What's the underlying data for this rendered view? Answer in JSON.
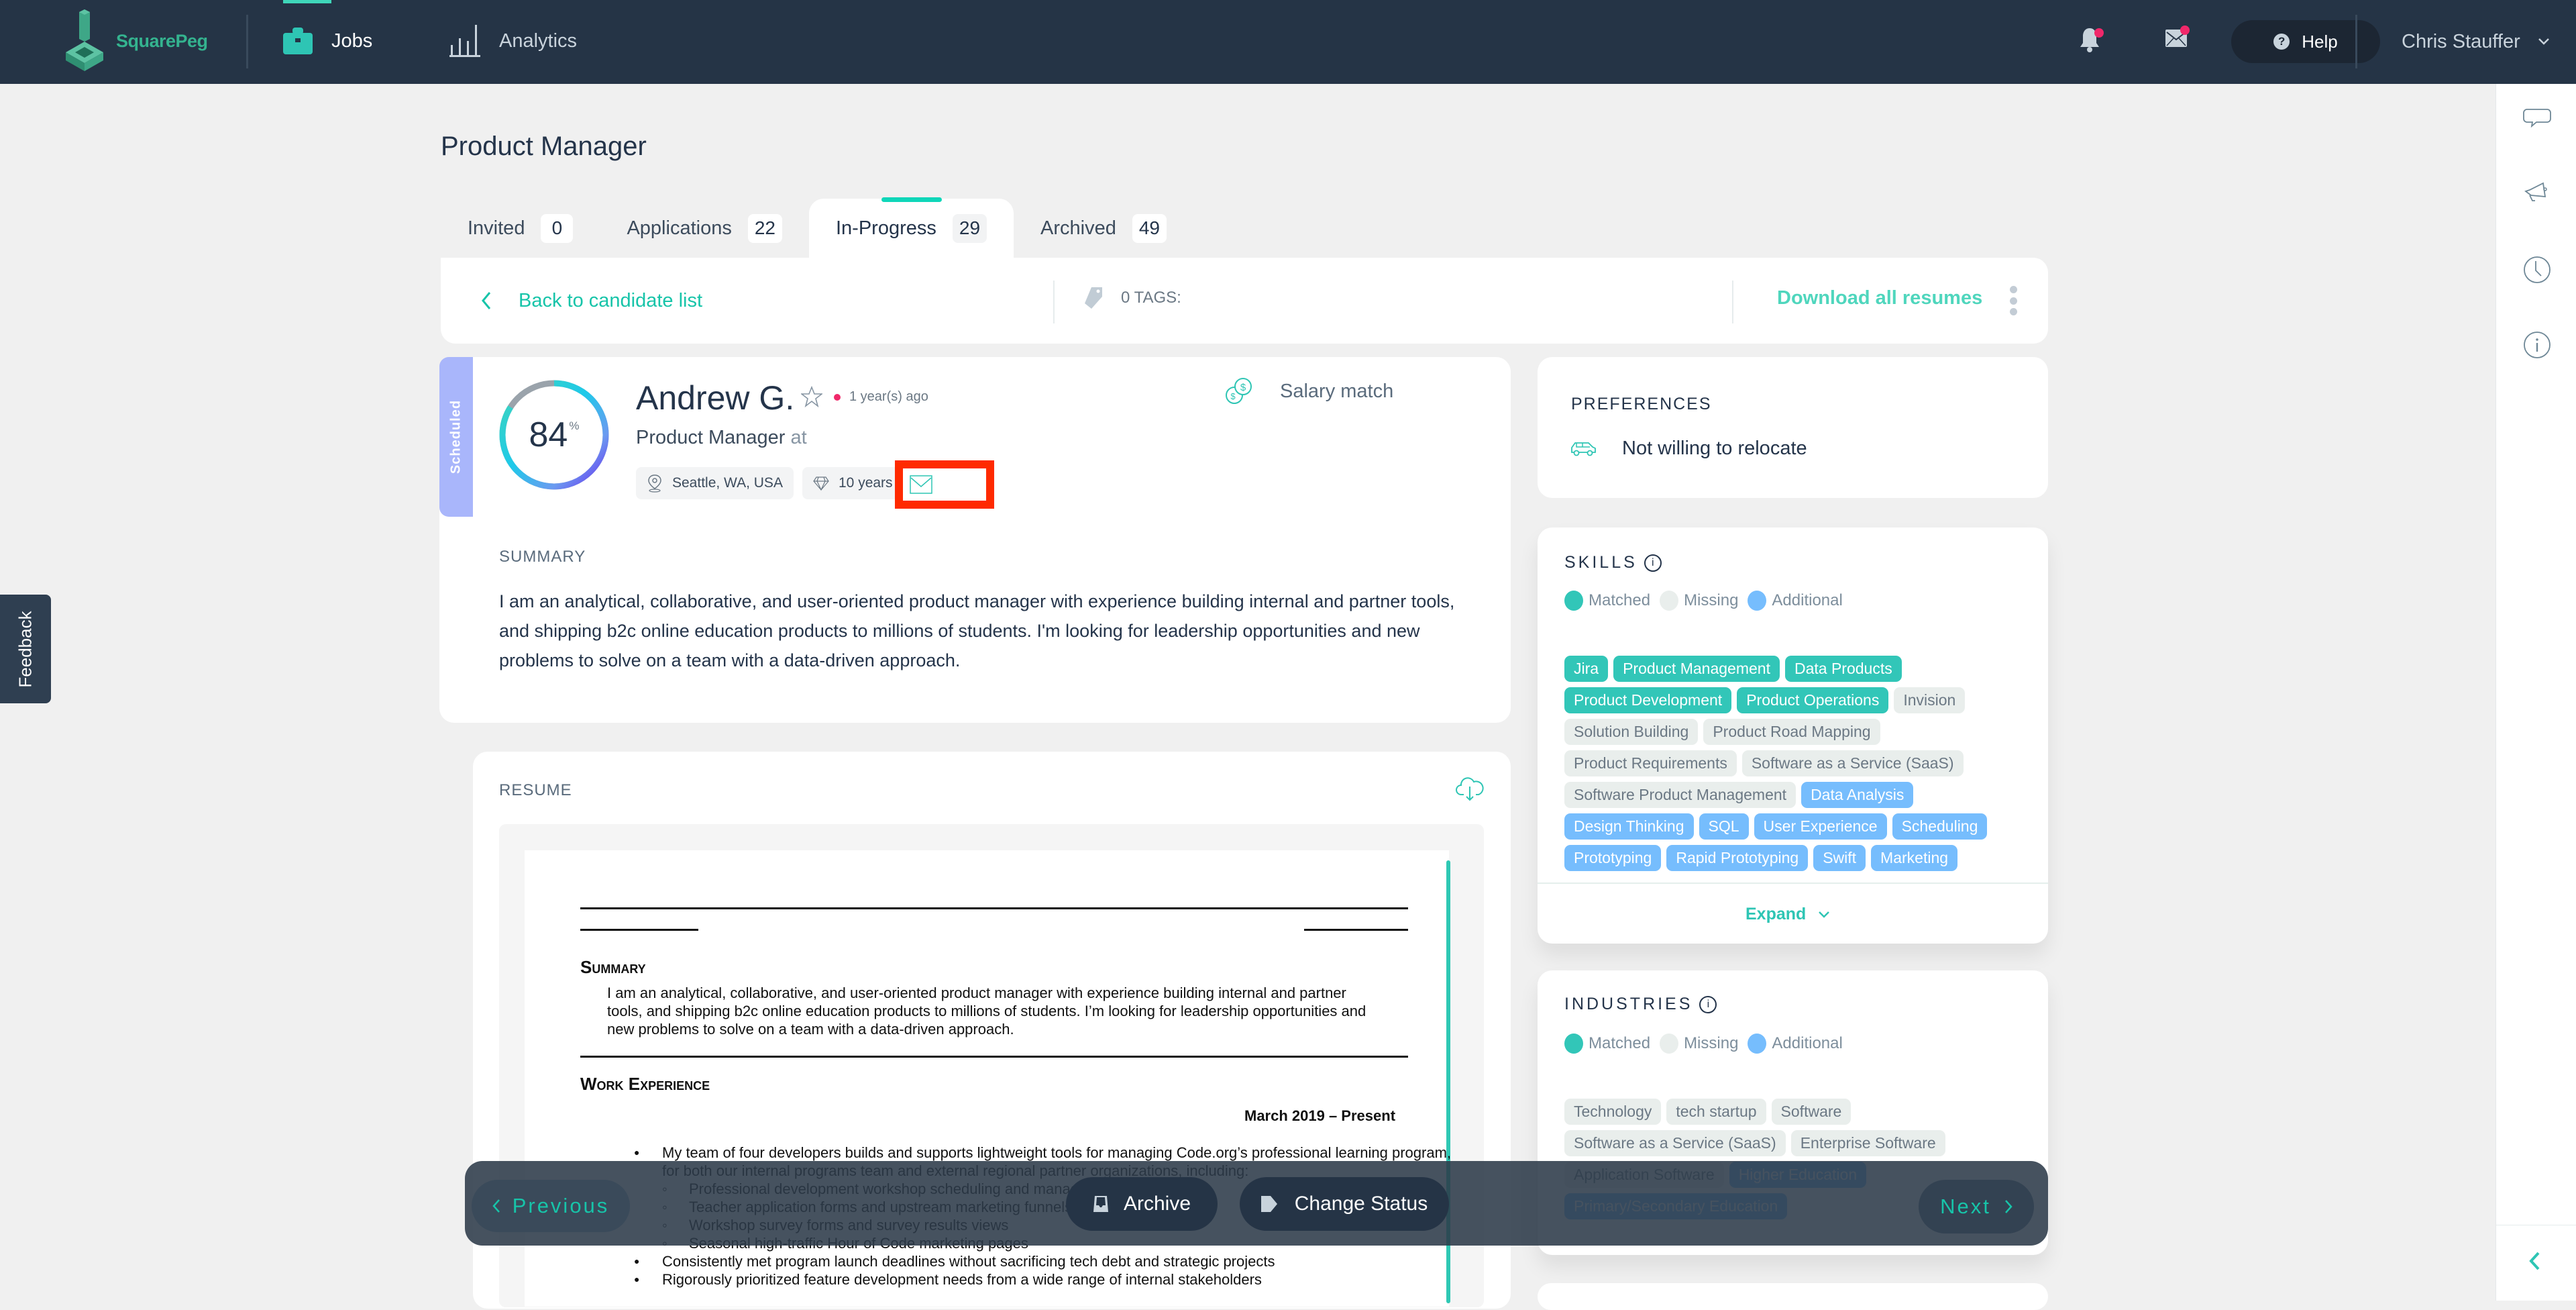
{
  "app": {
    "brand": "SquarePeg",
    "nav": [
      {
        "label": "Jobs",
        "icon": "briefcase-icon",
        "active": true
      },
      {
        "label": "Analytics",
        "icon": "bar-chart-icon",
        "active": false
      }
    ],
    "help_label": "Help",
    "user_name": "Chris Stauffer",
    "notifications_unread": true,
    "messages_unread": true
  },
  "feedback_label": "Feedback",
  "page": {
    "title": "Product Manager",
    "tabs": [
      {
        "label": "Invited",
        "count": "0"
      },
      {
        "label": "Applications",
        "count": "22"
      },
      {
        "label": "In-Progress",
        "count": "29",
        "active": true
      },
      {
        "label": "Archived",
        "count": "49"
      }
    ]
  },
  "toolbar": {
    "back_label": "Back to candidate list",
    "tags_label": "0 TAGS:",
    "download_label": "Download all resumes"
  },
  "candidate": {
    "status": "Scheduled",
    "score": 84,
    "score_unit": "%",
    "name": "Andrew G.",
    "recency": "1 year(s) ago",
    "role": "Product Manager",
    "role_at": "at",
    "location": "Seattle, WA, USA",
    "experience": "10 years",
    "salary_label": "Salary match",
    "summary_heading": "SUMMARY",
    "summary": "I am an analytical, collaborative, and user-oriented product manager with experience building internal and partner tools, and shipping b2c online education products to millions of students. I'm looking for leadership opportunities and new problems to solve on a team with a data-driven approach."
  },
  "resume": {
    "heading": "RESUME",
    "summary_heading": "Summary",
    "summary": "I am an analytical, collaborative, and user-oriented product manager with experience building internal and partner tools, and shipping b2c online education products to millions of students. I’m looking for leadership opportunities and new problems to solve on a team with a data-driven approach.",
    "work_heading": "Work Experience",
    "date_range": "March 2019 – Present",
    "bullets": [
      {
        "type": "b",
        "text": "My team of four developers builds and supports lightweight tools for managing Code.org’s professional learning program, for both our internal programs team and external regional partner organizations, including:"
      },
      {
        "type": "s",
        "text": "Professional development workshop scheduling and management tools"
      },
      {
        "type": "s",
        "text": "Teacher application forms and upstream marketing funnels"
      },
      {
        "type": "s",
        "text": "Workshop survey forms and survey results views"
      },
      {
        "type": "s",
        "text": "Seasonal high-traffic Hour of Code marketing pages"
      },
      {
        "type": "b",
        "text": "Consistently met program launch deadlines without sacrificing tech debt and strategic projects"
      },
      {
        "type": "b",
        "text": "Rigorously prioritized feature development needs from a wide range of internal stakeholders"
      }
    ]
  },
  "preferences": {
    "title": "PREFERENCES",
    "relocation": "Not willing to relocate"
  },
  "legend": {
    "matched": "Matched",
    "missing": "Missing",
    "additional": "Additional",
    "colors": {
      "matched": "#32c6b8",
      "missing": "#e9eeec",
      "additional": "#76bdfd"
    }
  },
  "skills": {
    "title": "SKILLS",
    "expand_label": "Expand",
    "tags": [
      {
        "label": "Jira",
        "type": "matched"
      },
      {
        "label": "Product Management",
        "type": "matched"
      },
      {
        "label": "Data Products",
        "type": "matched"
      },
      {
        "label": "Product Development",
        "type": "matched"
      },
      {
        "label": "Product Operations",
        "type": "matched"
      },
      {
        "label": "Invision",
        "type": "missing"
      },
      {
        "label": "Solution Building",
        "type": "missing"
      },
      {
        "label": "Product Road Mapping",
        "type": "missing"
      },
      {
        "label": "Product Requirements",
        "type": "missing"
      },
      {
        "label": "Software as a Service (SaaS)",
        "type": "missing"
      },
      {
        "label": "Software Product Management",
        "type": "missing"
      },
      {
        "label": "Data Analysis",
        "type": "additional"
      },
      {
        "label": "Design Thinking",
        "type": "additional"
      },
      {
        "label": "SQL",
        "type": "additional"
      },
      {
        "label": "User Experience",
        "type": "additional"
      },
      {
        "label": "Scheduling",
        "type": "additional"
      },
      {
        "label": "Prototyping",
        "type": "additional"
      },
      {
        "label": "Rapid Prototyping",
        "type": "additional"
      },
      {
        "label": "Swift",
        "type": "additional"
      },
      {
        "label": "Marketing",
        "type": "additional"
      }
    ]
  },
  "industries": {
    "title": "INDUSTRIES",
    "tags": [
      {
        "label": "Technology",
        "type": "missing"
      },
      {
        "label": "tech startup",
        "type": "missing"
      },
      {
        "label": "Software",
        "type": "missing"
      },
      {
        "label": "Software as a Service (SaaS)",
        "type": "missing"
      },
      {
        "label": "Enterprise Software",
        "type": "missing"
      },
      {
        "label": "Application Software",
        "type": "missing"
      },
      {
        "label": "Higher Education",
        "type": "additional"
      },
      {
        "label": "Primary/Secondary Education",
        "type": "additional"
      }
    ]
  },
  "actions": {
    "previous": "Previous",
    "archive": "Archive",
    "change_status": "Change Status",
    "next": "Next"
  }
}
